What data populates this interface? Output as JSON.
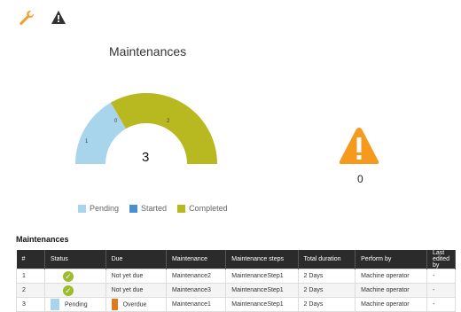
{
  "toolbar": {
    "icons": [
      "wrench-icon",
      "warning-icon"
    ],
    "wrench_color": "#f0a030",
    "warning_color": "#333333"
  },
  "gauge": {
    "title": "Maintenances",
    "center_value": "3",
    "segment_labels": [
      "1",
      "0",
      "2"
    ],
    "legend": [
      {
        "label": "Pending",
        "color": "#a8d4ec"
      },
      {
        "label": "Started",
        "color": "#4a8fd0"
      },
      {
        "label": "Completed",
        "color": "#b8b820"
      }
    ]
  },
  "alert": {
    "icon": "warning-triangle-icon",
    "color": "#f59a1c",
    "count": "0"
  },
  "table": {
    "title": "Maintenances",
    "headers": [
      "#",
      "Status",
      "Due",
      "Maintenance",
      "Maintenance steps",
      "Total duration",
      "Perform by",
      "Last edited by"
    ],
    "rows": [
      {
        "num": "1",
        "status": "check",
        "due": "Not yet due",
        "maintenance": "Maintenance2",
        "steps": "MaintenanceStep1",
        "duration": "2 Days",
        "perform_by": "Machine operator",
        "last_edited": "-"
      },
      {
        "num": "2",
        "status": "check",
        "due": "Not yet due",
        "maintenance": "Maintenance3",
        "steps": "MaintenanceStep1",
        "duration": "2 Days",
        "perform_by": "Machine operator",
        "last_edited": "-"
      },
      {
        "num": "3",
        "status": "Pending",
        "due": "Overdue",
        "maintenance": "Maintenance1",
        "steps": "MaintenanceStep1",
        "duration": "2 Days",
        "perform_by": "Machine operator",
        "last_edited": "-"
      }
    ],
    "pending_color": "#a8d4ec",
    "overdue_color": "#e07a1a"
  }
}
